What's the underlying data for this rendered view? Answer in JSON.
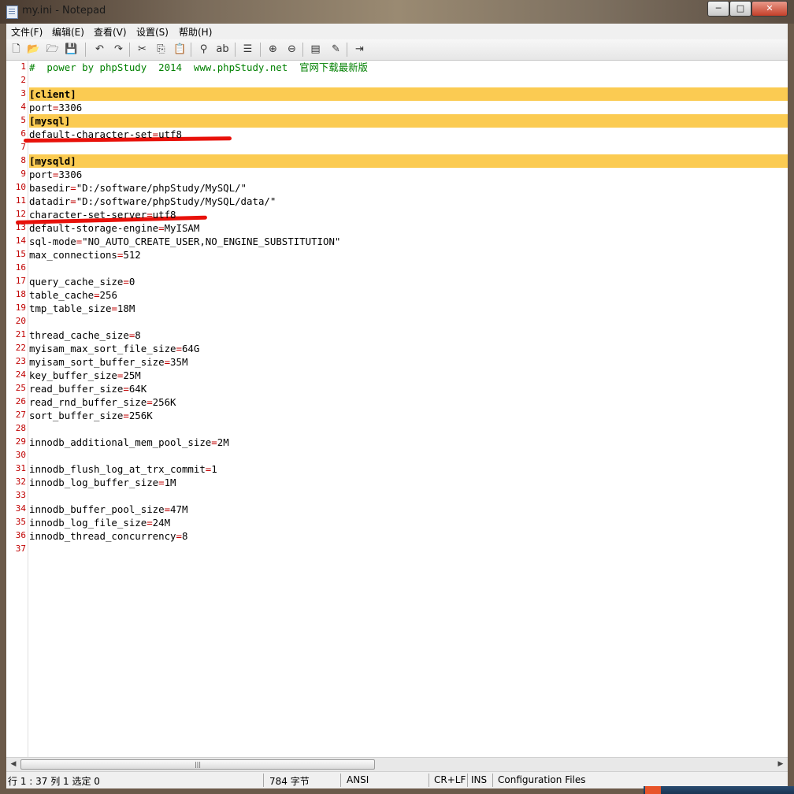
{
  "window": {
    "title": "my.ini - Notepad",
    "minimize_glyph": "─",
    "maximize_glyph": "□",
    "close_glyph": "✕"
  },
  "menu": [
    "文件(F)",
    "编辑(E)",
    "查看(V)",
    "设置(S)",
    "帮助(H)"
  ],
  "toolbar": {
    "buttons": [
      "new-file-icon",
      "open-file-icon",
      "open-folder-icon",
      "save-icon",
      "undo-icon",
      "redo-icon",
      "cut-icon",
      "copy-icon",
      "paste-icon",
      "find-icon",
      "replace-icon",
      "goto-icon",
      "zoom-in-icon",
      "zoom-out-icon",
      "view-options-icon",
      "scheme-icon",
      "exit-icon"
    ],
    "glyphs": [
      "🗋",
      "📂",
      "🗁",
      "💾",
      "↶",
      "↷",
      "✂",
      "⎘",
      "📋",
      "⚲",
      "ab",
      "☰",
      "⊕",
      "⊖",
      "▤",
      "✎",
      "⇥"
    ]
  },
  "editor": {
    "lines": [
      {
        "n": "1",
        "t": "#  power by phpStudy  2014  www.phpStudy.net  官网下载最新版",
        "kind": "comment"
      },
      {
        "n": "2",
        "t": "",
        "kind": "blank"
      },
      {
        "n": "3",
        "t": "[client]",
        "kind": "section"
      },
      {
        "n": "4",
        "k": "port",
        "v": "3306",
        "kind": "kv"
      },
      {
        "n": "5",
        "t": "[mysql]",
        "kind": "section"
      },
      {
        "n": "6",
        "k": "default-character-set",
        "v": "utf8",
        "kind": "kv"
      },
      {
        "n": "7",
        "t": "",
        "kind": "blank"
      },
      {
        "n": "8",
        "t": "[mysqld]",
        "kind": "section"
      },
      {
        "n": "9",
        "k": "port",
        "v": "3306",
        "kind": "kv"
      },
      {
        "n": "10",
        "k": "basedir",
        "v": "\"D:/software/phpStudy/MySQL/\"",
        "kind": "kv"
      },
      {
        "n": "11",
        "k": "datadir",
        "v": "\"D:/software/phpStudy/MySQL/data/\"",
        "kind": "kv"
      },
      {
        "n": "12",
        "k": "character-set-server",
        "v": "utf8",
        "kind": "kv"
      },
      {
        "n": "13",
        "k": "default-storage-engine",
        "v": "MyISAM",
        "kind": "kv"
      },
      {
        "n": "14",
        "k": "sql-mode",
        "v": "\"NO_AUTO_CREATE_USER,NO_ENGINE_SUBSTITUTION\"",
        "kind": "kv"
      },
      {
        "n": "15",
        "k": "max_connections",
        "v": "512",
        "kind": "kv"
      },
      {
        "n": "16",
        "t": "",
        "kind": "blank"
      },
      {
        "n": "17",
        "k": "query_cache_size",
        "v": "0",
        "kind": "kv"
      },
      {
        "n": "18",
        "k": "table_cache",
        "v": "256",
        "kind": "kv"
      },
      {
        "n": "19",
        "k": "tmp_table_size",
        "v": "18M",
        "kind": "kv"
      },
      {
        "n": "20",
        "t": "",
        "kind": "blank"
      },
      {
        "n": "21",
        "k": "thread_cache_size",
        "v": "8",
        "kind": "kv"
      },
      {
        "n": "22",
        "k": "myisam_max_sort_file_size",
        "v": "64G",
        "kind": "kv"
      },
      {
        "n": "23",
        "k": "myisam_sort_buffer_size",
        "v": "35M",
        "kind": "kv"
      },
      {
        "n": "24",
        "k": "key_buffer_size",
        "v": "25M",
        "kind": "kv"
      },
      {
        "n": "25",
        "k": "read_buffer_size",
        "v": "64K",
        "kind": "kv"
      },
      {
        "n": "26",
        "k": "read_rnd_buffer_size",
        "v": "256K",
        "kind": "kv"
      },
      {
        "n": "27",
        "k": "sort_buffer_size",
        "v": "256K",
        "kind": "kv"
      },
      {
        "n": "28",
        "t": "",
        "kind": "blank"
      },
      {
        "n": "29",
        "k": "innodb_additional_mem_pool_size",
        "v": "2M",
        "kind": "kv"
      },
      {
        "n": "30",
        "t": "",
        "kind": "blank"
      },
      {
        "n": "31",
        "k": "innodb_flush_log_at_trx_commit",
        "v": "1",
        "kind": "kv"
      },
      {
        "n": "32",
        "k": "innodb_log_buffer_size",
        "v": "1M",
        "kind": "kv"
      },
      {
        "n": "33",
        "t": "",
        "kind": "blank"
      },
      {
        "n": "34",
        "k": "innodb_buffer_pool_size",
        "v": "47M",
        "kind": "kv"
      },
      {
        "n": "35",
        "k": "innodb_log_file_size",
        "v": "24M",
        "kind": "kv"
      },
      {
        "n": "36",
        "k": "innodb_thread_concurrency",
        "v": "8",
        "kind": "kv"
      },
      {
        "n": "37",
        "t": "",
        "kind": "blank"
      }
    ],
    "section_highlight_color": "#fbcb52",
    "line_number_color": "#c00000",
    "annotation_color": "#e8110a",
    "annotated_lines": [
      "6",
      "12"
    ]
  },
  "scrollbar": {
    "left_arrow": "◀",
    "right_arrow": "▶",
    "thumb_grip": "|||"
  },
  "status": {
    "position": "行 1 : 37   列 1   选定 0",
    "size": "784 字节",
    "encoding": "ANSI",
    "eol": "CR+LF",
    "mode": "INS",
    "scheme": "Configuration Files"
  }
}
